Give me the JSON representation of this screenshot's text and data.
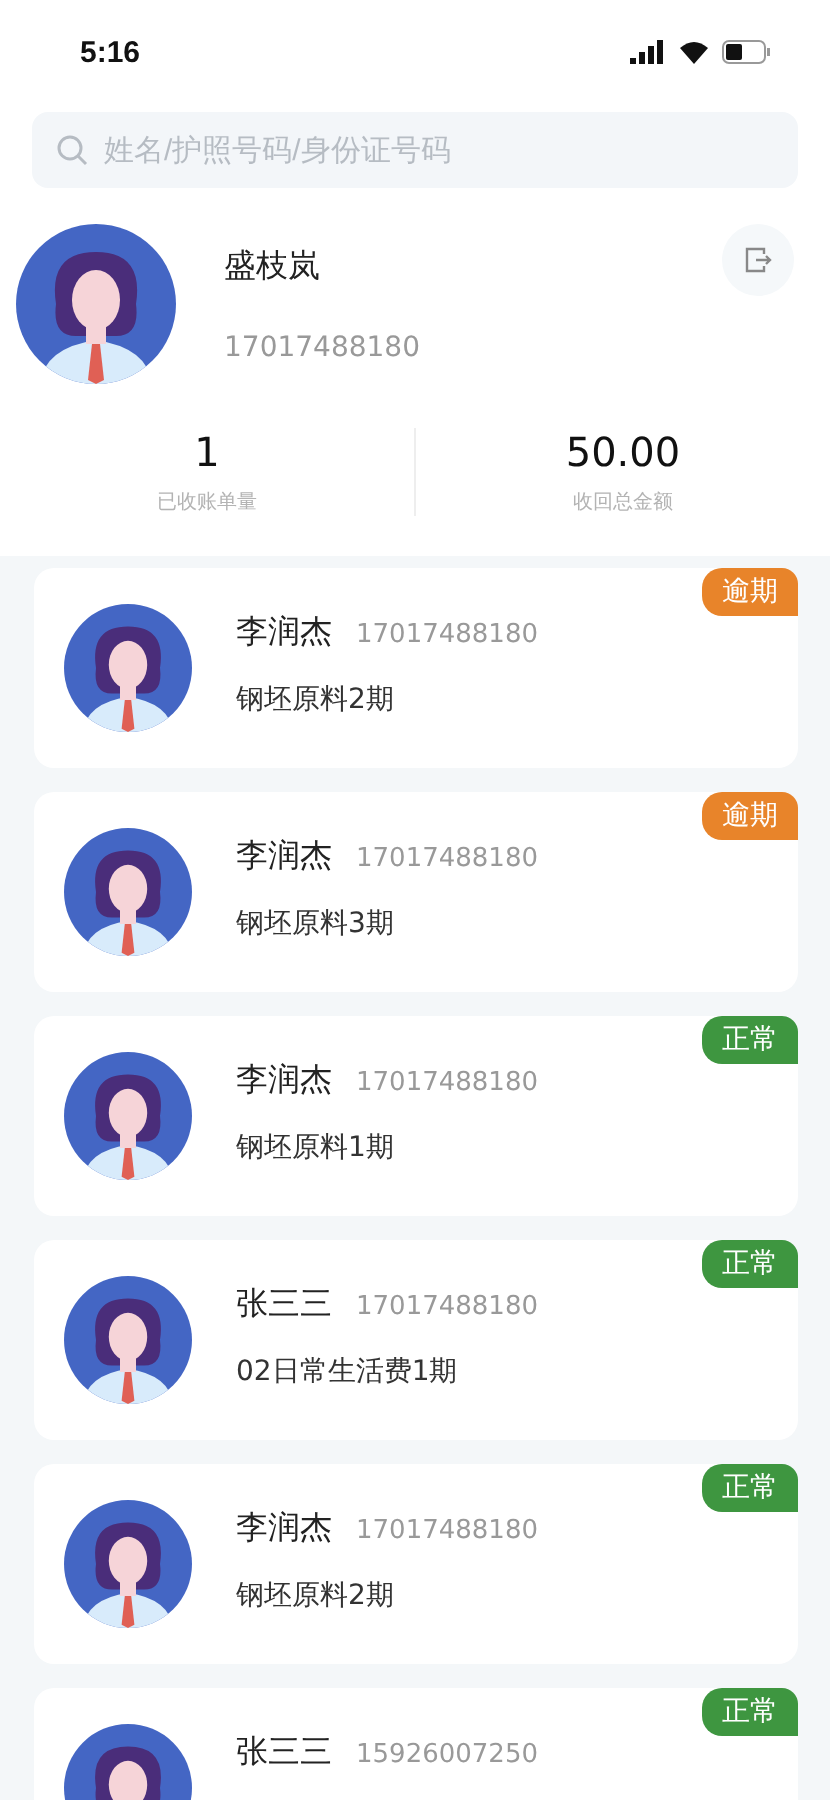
{
  "status_bar": {
    "time": "5:16"
  },
  "search": {
    "placeholder": "姓名/护照号码/身份证号码"
  },
  "profile": {
    "name": "盛枝岚",
    "phone": "17017488180"
  },
  "stats": [
    {
      "value": "1",
      "label": "已收账单量"
    },
    {
      "value": "50.00",
      "label": "收回总金额"
    }
  ],
  "records": [
    {
      "name": "李润杰",
      "phone": "17017488180",
      "item": "钢坯原料2期",
      "kind": "overdue",
      "badge": "逾期"
    },
    {
      "name": "李润杰",
      "phone": "17017488180",
      "item": "钢坯原料3期",
      "kind": "overdue",
      "badge": "逾期"
    },
    {
      "name": "李润杰",
      "phone": "17017488180",
      "item": "钢坯原料1期",
      "kind": "normal",
      "badge": "正常"
    },
    {
      "name": "张三三",
      "phone": "17017488180",
      "item": "02日常生活费1期",
      "kind": "normal",
      "badge": "正常"
    },
    {
      "name": "李润杰",
      "phone": "17017488180",
      "item": "钢坯原料2期",
      "kind": "normal",
      "badge": "正常"
    },
    {
      "name": "张三三",
      "phone": "15926007250",
      "kind": "normal",
      "badge": "正常"
    }
  ]
}
